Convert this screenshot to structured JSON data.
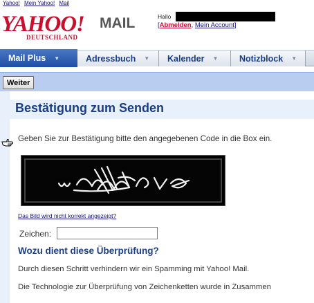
{
  "top_links": [
    "Yahoo!",
    "Mein Yahoo!",
    "Mail"
  ],
  "logo": {
    "brand": "YAHOO!",
    "product": "MAIL",
    "region": "DEUTSCHLAND"
  },
  "account": {
    "greeting": "Hallo",
    "logout": "Abmelden",
    "my_account": "Mein Account"
  },
  "tabs": [
    {
      "label": "Mail Plus"
    },
    {
      "label": "Adressbuch"
    },
    {
      "label": "Kalender"
    },
    {
      "label": "Notizblock"
    }
  ],
  "toolbar": {
    "continue_label": "Weiter"
  },
  "main": {
    "title": "Bestätigung zum Senden",
    "instruction": "Geben Sie zur Bestätigung bitte den angegebenen Code in die Box ein.",
    "image_problem_link": "Das Bild wird nicht korrekt angezeigt?",
    "field_label": "Zeichen:",
    "field_value": "",
    "why_heading": "Wozu dient diese Überprüfung?",
    "paragraph_1": "Durch diesen Schritt verhindern wir ein Spamming mit Yahoo! Mail.",
    "paragraph_2": "Die Technologie zur Überprüfung von Zeichenketten wurde in Zusammen"
  },
  "colors": {
    "brand_red": "#c8102e",
    "link_blue": "#12127a",
    "heading_blue": "#1a3d85",
    "tab_active": "#1e4ea4",
    "toolbar_bg": "#b9cdf0"
  },
  "icons": {
    "pointer": "hand-pointer-icon",
    "tab_dropdown": "chevron-down-icon"
  }
}
